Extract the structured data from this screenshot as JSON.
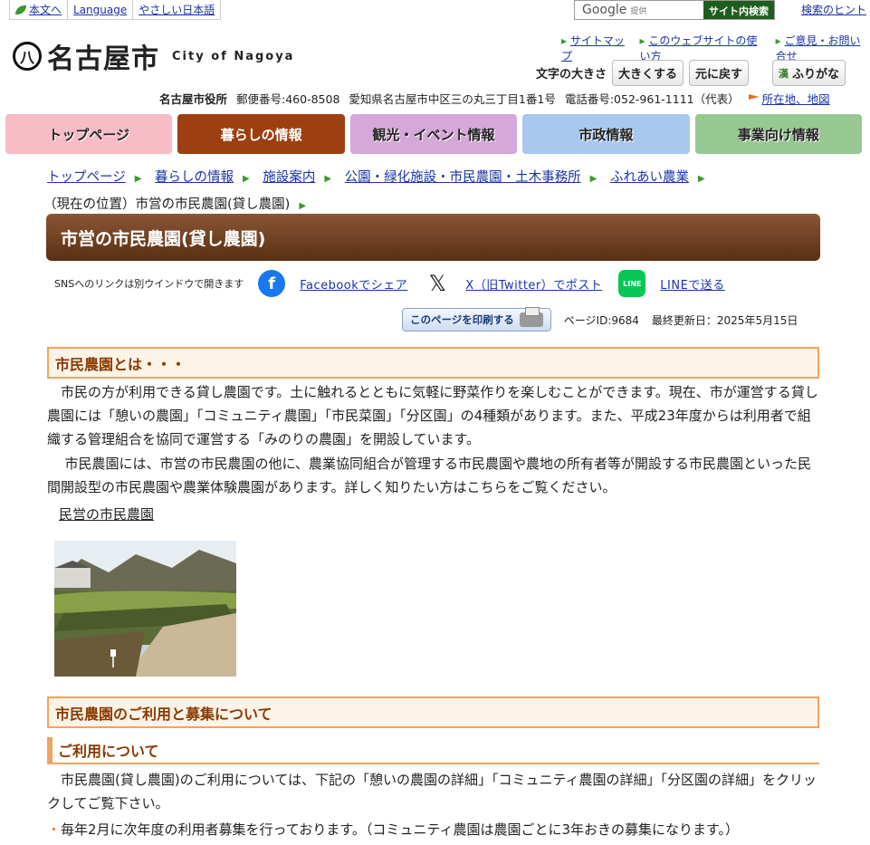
{
  "utility": {
    "main": "本文へ",
    "language": "Language",
    "easy": "やさしい日本語"
  },
  "search": {
    "brand": "Google",
    "provided": "提供",
    "button": "サイト内検索",
    "hint": "検索のヒント"
  },
  "logo": {
    "mark": "八",
    "name": "名古屋市",
    "english": "City of Nagoya"
  },
  "help_links": [
    "サイトマップ",
    "このウェブサイトの使い方",
    "ご意見・お問い合せ"
  ],
  "font_size": {
    "label": "文字の大きさ",
    "bigger": "大きくする",
    "reset": "元に戻す",
    "furigana": "ふりがな",
    "furigana_mark": "漢"
  },
  "address": {
    "office": "名古屋市役所",
    "postal": "郵便番号:460-8508",
    "addr": "愛知県名古屋市中区三の丸三丁目1番1号",
    "phone": "電話番号:052-961-1111（代表）",
    "map": "所在地、地図"
  },
  "nav": [
    "トップページ",
    "暮らしの情報",
    "観光・イベント情報",
    "市政情報",
    "事業向け情報"
  ],
  "breadcrumb": {
    "items": [
      "トップページ",
      "暮らしの情報",
      "施設案内",
      "公園・緑化施設・市民農園・土木事務所",
      "ふれあい農業"
    ],
    "current": "（現在の位置）市営の市民農園(貸し農園)"
  },
  "page_title": "市営の市民農園(貸し農園)",
  "sns": {
    "note": "SNSへのリンクは別ウインドウで開きます",
    "facebook": "Facebookでシェア",
    "x": "X（旧Twitter）でポスト",
    "line": "LINEで送る",
    "line_icon": "LINE"
  },
  "meta": {
    "print": "このページを印刷する",
    "page_id": "ページID:9684",
    "updated": "最終更新日：2025年5月15日"
  },
  "section1": {
    "heading": "市民農園とは・・・",
    "p1": "市民の方が利用できる貸し農園です。土に触れるとともに気軽に野菜作りを楽しむことができます。現在、市が運営する貸し農園には「憩いの農園」「コミュニティ農園」「市民菜園」「分区園」の4種類があります。また、平成23年度からは利用者で組織する管理組合を協同で運営する「みのりの農園」を開設しています。",
    "p2": "市民農園には、市営の市民農園の他に、農業協同組合が管理する市民農園や農地の所有者等が開設する市民農園といった民間開設型の市民農園や農業体験農園があります。詳しく知りたい方はこちらをご覧ください。",
    "link": "民営の市民農園"
  },
  "section2": {
    "heading": "市民農園のご利用と募集について",
    "sub": "ご利用について",
    "p1": "市民農園(貸し農園)のご利用については、下記の「憩いの農園の詳細」「コミュニティ農園の詳細」「分区園の詳細」をクリックしてご覧下さい。",
    "bullet1": "毎年2月に次年度の利用者募集を行っております。（コミュニティ農園は農園ごとに3年おきの募集になります。）"
  },
  "colors": {
    "brown": "#9c4012",
    "accent": "#f0a460",
    "link": "#1a33aa"
  }
}
